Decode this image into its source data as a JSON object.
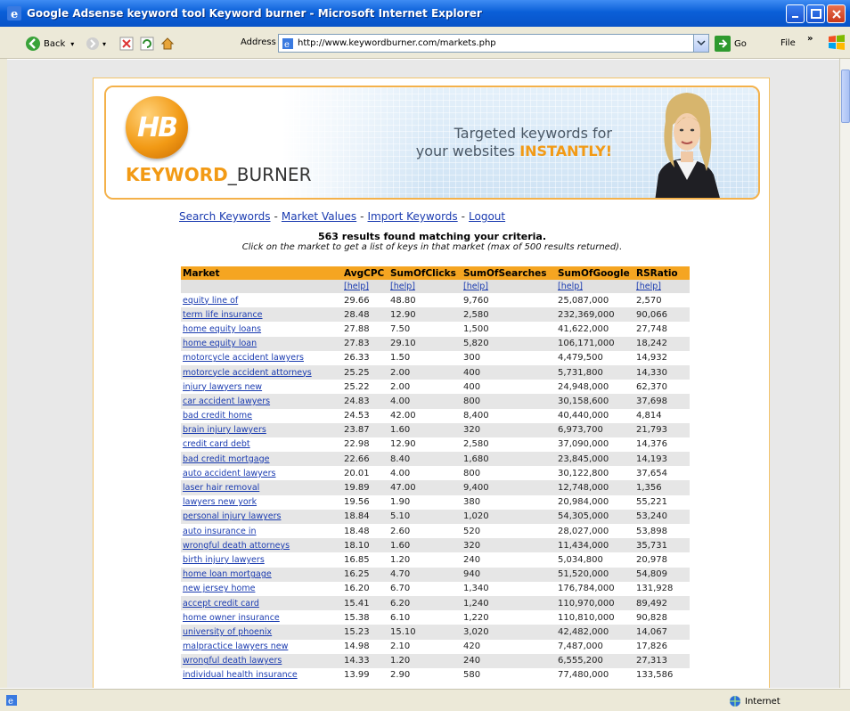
{
  "window": {
    "title": "Google Adsense keyword tool Keyword burner - Microsoft Internet Explorer"
  },
  "toolbar": {
    "back_label": "Back",
    "address_label": "Address",
    "url": "http://www.keywordburner.com/markets.php",
    "go_label": "Go",
    "file_menu": "File",
    "chevron": "»"
  },
  "banner": {
    "logo_letters": "HB",
    "brand_keyword": "KEYWORD",
    "brand_rest": "_BURNER",
    "tagline_line1": "Targeted keywords for",
    "tagline_line2_prefix": "your websites ",
    "tagline_highlight": "INSTANTLY!"
  },
  "nav": {
    "links": [
      "Search Keywords",
      "Market Values",
      "Import Keywords",
      "Logout"
    ],
    "separator": "-"
  },
  "results": {
    "headline": "563 results found matching your criteria.",
    "subline": "Click on the market to get a list of keys in that market (max of 500 results returned)."
  },
  "table": {
    "headers": [
      "Market",
      "AvgCPC",
      "SumOfClicks",
      "SumOfSearches",
      "SumOfGoogle",
      "RSRatio"
    ],
    "help_label": "[help]",
    "rows": [
      [
        "equity line of",
        "29.66",
        "48.80",
        "9,760",
        "25,087,000",
        "2,570"
      ],
      [
        "term life insurance",
        "28.48",
        "12.90",
        "2,580",
        "232,369,000",
        "90,066"
      ],
      [
        "home equity loans",
        "27.88",
        "7.50",
        "1,500",
        "41,622,000",
        "27,748"
      ],
      [
        "home equity loan",
        "27.83",
        "29.10",
        "5,820",
        "106,171,000",
        "18,242"
      ],
      [
        "motorcycle accident lawyers",
        "26.33",
        "1.50",
        "300",
        "4,479,500",
        "14,932"
      ],
      [
        "motorcycle accident attorneys",
        "25.25",
        "2.00",
        "400",
        "5,731,800",
        "14,330"
      ],
      [
        "injury lawyers new",
        "25.22",
        "2.00",
        "400",
        "24,948,000",
        "62,370"
      ],
      [
        "car accident lawyers",
        "24.83",
        "4.00",
        "800",
        "30,158,600",
        "37,698"
      ],
      [
        "bad credit home",
        "24.53",
        "42.00",
        "8,400",
        "40,440,000",
        "4,814"
      ],
      [
        "brain injury lawyers",
        "23.87",
        "1.60",
        "320",
        "6,973,700",
        "21,793"
      ],
      [
        "credit card debt",
        "22.98",
        "12.90",
        "2,580",
        "37,090,000",
        "14,376"
      ],
      [
        "bad credit mortgage",
        "22.66",
        "8.40",
        "1,680",
        "23,845,000",
        "14,193"
      ],
      [
        "auto accident lawyers",
        "20.01",
        "4.00",
        "800",
        "30,122,800",
        "37,654"
      ],
      [
        "laser hair removal",
        "19.89",
        "47.00",
        "9,400",
        "12,748,000",
        "1,356"
      ],
      [
        "lawyers new york",
        "19.56",
        "1.90",
        "380",
        "20,984,000",
        "55,221"
      ],
      [
        "personal injury lawyers",
        "18.84",
        "5.10",
        "1,020",
        "54,305,000",
        "53,240"
      ],
      [
        "auto insurance in",
        "18.48",
        "2.60",
        "520",
        "28,027,000",
        "53,898"
      ],
      [
        "wrongful death attorneys",
        "18.10",
        "1.60",
        "320",
        "11,434,000",
        "35,731"
      ],
      [
        "birth injury lawyers",
        "16.85",
        "1.20",
        "240",
        "5,034,800",
        "20,978"
      ],
      [
        "home loan mortgage",
        "16.25",
        "4.70",
        "940",
        "51,520,000",
        "54,809"
      ],
      [
        "new jersey home",
        "16.20",
        "6.70",
        "1,340",
        "176,784,000",
        "131,928"
      ],
      [
        "accept credit card",
        "15.41",
        "6.20",
        "1,240",
        "110,970,000",
        "89,492"
      ],
      [
        "home owner insurance",
        "15.38",
        "6.10",
        "1,220",
        "110,810,000",
        "90,828"
      ],
      [
        "university of phoenix",
        "15.23",
        "15.10",
        "3,020",
        "42,482,000",
        "14,067"
      ],
      [
        "malpractice lawyers new",
        "14.98",
        "2.10",
        "420",
        "7,487,000",
        "17,826"
      ],
      [
        "wrongful death lawyers",
        "14.33",
        "1.20",
        "240",
        "6,555,200",
        "27,313"
      ],
      [
        "individual health insurance",
        "13.99",
        "2.90",
        "580",
        "77,480,000",
        "133,586"
      ]
    ]
  },
  "status": {
    "zone": "Internet"
  },
  "colors": {
    "table_header": "#f5a521",
    "link": "#1a3bb0",
    "brand_orange": "#f29a15"
  }
}
